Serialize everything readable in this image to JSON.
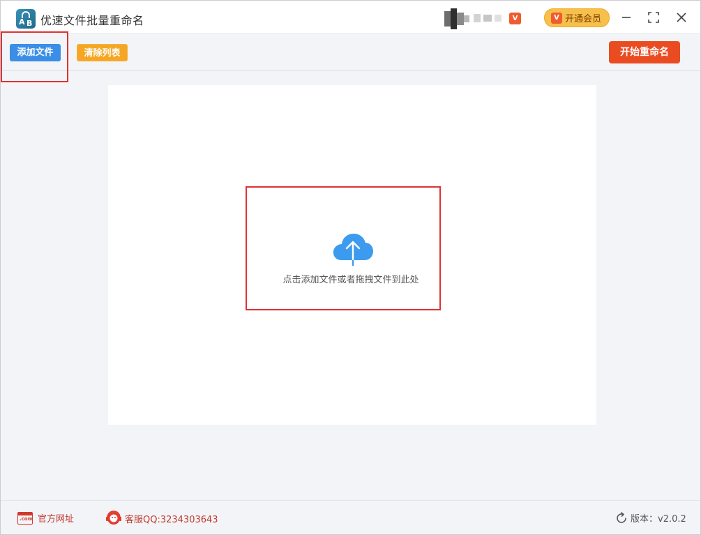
{
  "app": {
    "title": "优速文件批量重命名",
    "logo_letters": [
      "A",
      "B"
    ]
  },
  "titlebar": {
    "vip_badge_small": "V",
    "vip_button_icon": "V",
    "vip_button_label": "开通会员",
    "controls": [
      "minimize-icon",
      "maximize-icon",
      "close-icon"
    ]
  },
  "toolbar": {
    "add_files_label": "添加文件",
    "clear_list_label": "清除列表",
    "start_rename_label": "开始重命名"
  },
  "drop_zone": {
    "icon": "cloud-upload-icon",
    "hint": "点击添加文件或者拖拽文件到此处"
  },
  "statusbar": {
    "website_icon_text": ".com",
    "website_label": "官方网址",
    "qq_label": "客服QQ:3234303643",
    "version_label": "版本：v2.0.2"
  },
  "colors": {
    "accent_blue": "#3a8ee6",
    "clear_orange": "#f6a623",
    "start_red": "#ea4c22",
    "vip_yellow": "#f7c04a",
    "highlight_red": "#e03131",
    "cloud_blue": "#3d9bef"
  }
}
